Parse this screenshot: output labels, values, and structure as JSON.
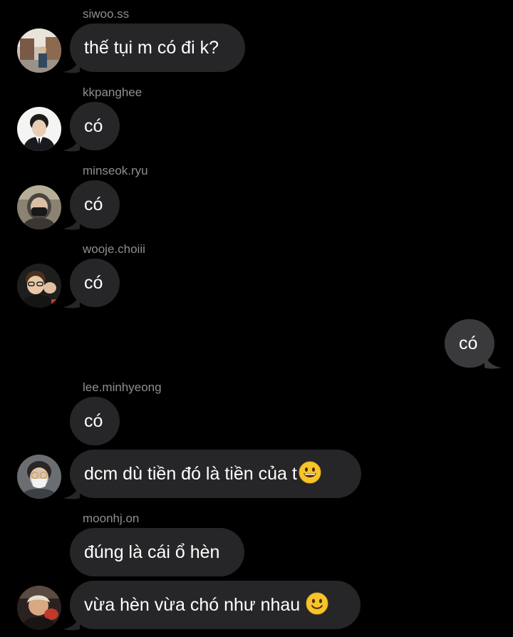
{
  "messages": [
    {
      "sender": "siwoo.ss",
      "text": "thế tụi m có đi k?"
    },
    {
      "sender": "kkpanghee",
      "text": "có"
    },
    {
      "sender": "minseok.ryu",
      "text": "có"
    },
    {
      "sender": "wooje.choiii",
      "text": "có"
    },
    {
      "sender": "me",
      "text": "có"
    },
    {
      "sender": "lee.minhyeong",
      "text": "có"
    },
    {
      "sender": "lee.minhyeong",
      "text": "dcm dù tiền đó là tiền của t",
      "emoji": "grinning-face-emoji"
    },
    {
      "sender": "moonhj.on",
      "text": "đúng là cái ổ hèn"
    },
    {
      "sender": "moonhj.on",
      "text": "vừa hèn vừa chó như nhau",
      "emoji": "slightly-smiling-face-emoji"
    }
  ],
  "colors": {
    "background": "#000000",
    "incoming_bubble": "#262628",
    "outgoing_bubble": "#3a3a3c",
    "username": "#8e8e93",
    "text": "#ffffff"
  }
}
